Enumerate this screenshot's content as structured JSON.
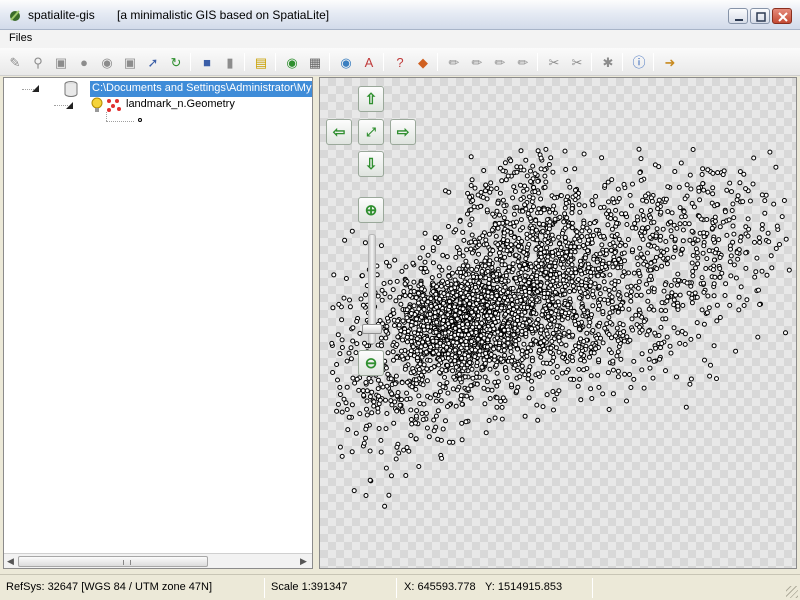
{
  "window": {
    "app_name": "spatialite-gis",
    "subtitle": "[a minimalistic GIS based on SpatiaLite]",
    "icon": "feather-pen-icon"
  },
  "menu": {
    "items": [
      "Files"
    ]
  },
  "toolbar": {
    "icons": [
      "connect-db-icon",
      "disconnect-db-icon",
      "create-db-icon",
      "db-memory-icon",
      "db-vacuum-icon",
      "db-save-icon",
      "plug-icon",
      "refresh-icon",
      "layer-table-icon",
      "layer-delete-icon",
      "style-icon",
      "globe-icon",
      "table-icon",
      "zoom-map-icon",
      "text-label-icon",
      "identify-icon",
      "select-icon",
      "pen-icon",
      "pen-edit-icon",
      "pen-move-icon",
      "pen-delete-icon",
      "cut-icon",
      "cut-alt-icon",
      "star-icon",
      "help-icon",
      "exit-icon"
    ]
  },
  "tree": {
    "root_label": "C:\\Documents and Settings\\Administrator\\My",
    "layer_label": "landmark_n.Geometry",
    "root_icon": "database-icon",
    "layer_icons": [
      "bulb-icon",
      "points-layer-icon"
    ]
  },
  "map": {
    "background": "checkerboard",
    "point_color": "#000000",
    "nav_icons": [
      "arrow-up-icon",
      "arrow-left-icon",
      "zoom-extent-icon",
      "arrow-right-icon",
      "arrow-down-icon",
      "zoom-in-icon",
      "zoom-out-icon"
    ],
    "zoom_level": 0.85
  },
  "status": {
    "refsys": "RefSys: 32647 [WGS 84 / UTM zone 47N]",
    "scale": "Scale 1:391347",
    "x": "X: 645593.778",
    "y": "Y: 1514915.853"
  },
  "colors": {
    "selection": "#3f8cd8",
    "nav_arrow": "#2f8f2f"
  }
}
